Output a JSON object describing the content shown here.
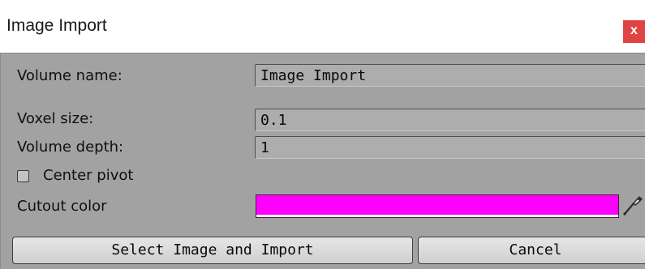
{
  "window": {
    "title": "Image Import",
    "close_label": "x"
  },
  "form": {
    "volume_name_label": "Volume name:",
    "volume_name_value": "Image Import",
    "voxel_size_label": "Voxel size:",
    "voxel_size_value": "0.1",
    "volume_depth_label": "Volume depth:",
    "volume_depth_value": "1",
    "center_pivot_label": "Center pivot",
    "center_pivot_checked": false,
    "cutout_color_label": "Cutout color",
    "cutout_color_value": "#ff00ff",
    "eyedropper_icon": "eyedropper-icon"
  },
  "buttons": {
    "select_import_label": "Select Image and Import",
    "cancel_label": "Cancel"
  },
  "colors": {
    "panel_bg": "#a2a2a2",
    "close_bg": "#e04343",
    "cutout": "#ff00ff"
  }
}
